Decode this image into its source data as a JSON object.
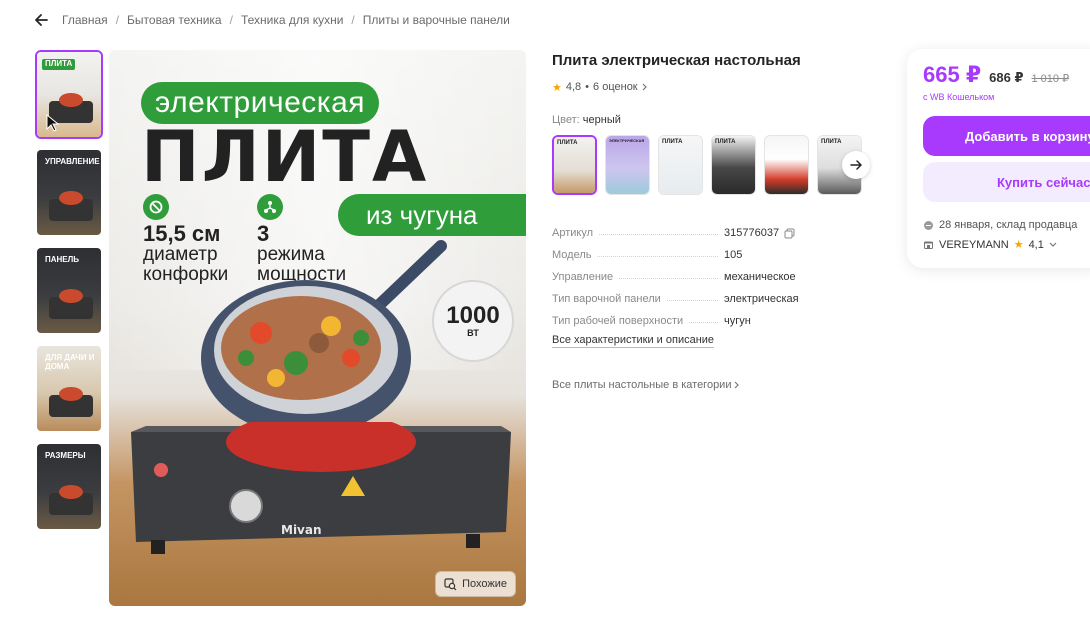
{
  "breadcrumb": {
    "items": [
      "Главная",
      "Бытовая техника",
      "Техника для кухни",
      "Плиты и варочные панели"
    ]
  },
  "thumbnails": [
    {
      "label": "ПЛИТА",
      "style": "light"
    },
    {
      "label": "УПРАВЛЕНИЕ",
      "style": "dark"
    },
    {
      "label": "ПАНЕЛЬ",
      "style": "dark"
    },
    {
      "label": "ДЛЯ ДАЧИ И ДОМА",
      "style": "warm"
    },
    {
      "label": "РАЗМЕРЫ",
      "style": "dark"
    }
  ],
  "hero": {
    "pill_top": "электрическая",
    "title": "ПЛИТА",
    "pill_right": "из чугуна",
    "feature1_value": "15,5 см",
    "feature1_text1": "диаметр",
    "feature1_text2": "конфорки",
    "feature2_value": "3",
    "feature2_text1": "режима",
    "feature2_text2": "мощности",
    "power_value": "1000",
    "power_unit": "ВТ",
    "brand": "Mivan",
    "similar_button": "Похожие"
  },
  "product": {
    "title": "Плита электрическая настольная",
    "rating": "4,8",
    "reviews": "6 оценок",
    "color_label": "Цвет:",
    "color_value": "черный",
    "swatches": [
      {
        "label": "ПЛИТА",
        "style": "t1"
      },
      {
        "label": "ЭЛЕКТРИЧЕСКАЯ",
        "style": "t2"
      },
      {
        "label": "ПЛИТА",
        "style": "t3"
      },
      {
        "label": "ПЛИТА",
        "style": "t4"
      },
      {
        "label": "",
        "style": "t5"
      },
      {
        "label": "ПЛИТА",
        "style": "t6"
      }
    ],
    "specs": [
      {
        "key": "Артикул",
        "value": "315776037"
      },
      {
        "key": "Модель",
        "value": "105"
      },
      {
        "key": "Управление",
        "value": "механическое"
      },
      {
        "key": "Тип варочной панели",
        "value": "электрическая"
      },
      {
        "key": "Тип рабочей поверхности",
        "value": "чугун"
      }
    ],
    "all_specs_link": "Все характеристики и описание",
    "category_link": "Все плиты настольные в категории"
  },
  "price_card": {
    "price": "665 ₽",
    "price_second": "686 ₽",
    "price_old": "1 010 ₽",
    "wallet_note": "с WB Кошельком",
    "add_to_cart": "Добавить в корзину",
    "buy_now": "Купить сейчас",
    "delivery": "28 января, склад продавца",
    "seller": "VEREYMANN",
    "seller_rating": "4,1"
  },
  "colors": {
    "accent": "#a73afd",
    "green": "#2e9d3a",
    "star": "#f7a600"
  }
}
